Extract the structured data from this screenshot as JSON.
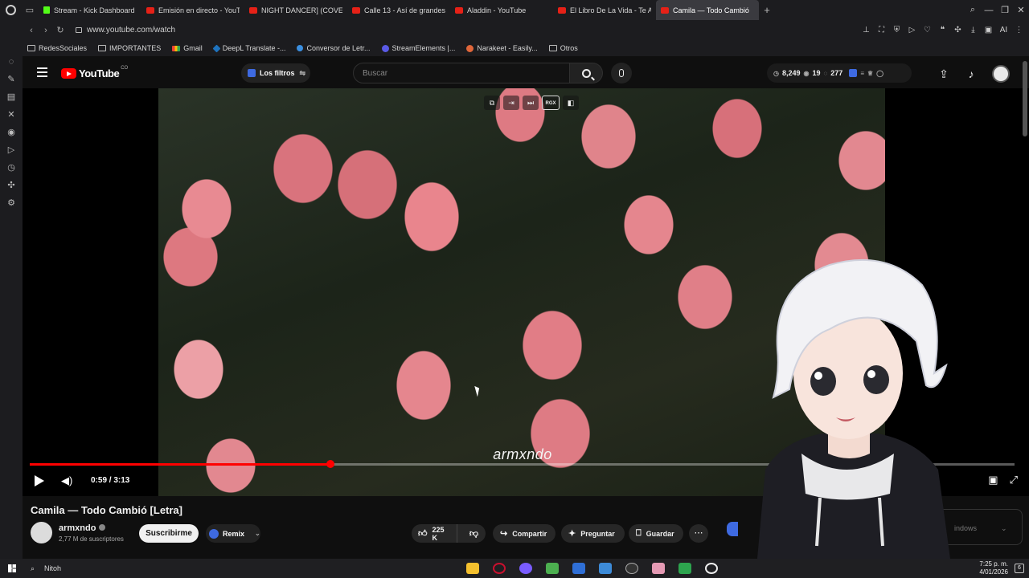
{
  "browser": {
    "tabs": [
      {
        "label": "Stream - Kick Dashboard",
        "icon": "kick-icon"
      },
      {
        "label": "Emisión en directo - YouTube",
        "icon": "youtube-icon"
      },
      {
        "label": "NIGHT DANCER] (COVER",
        "icon": "youtube-icon"
      },
      {
        "label": "Calle 13 - Así de grandes",
        "icon": "youtube-icon"
      },
      {
        "label": "Aladdin - YouTube",
        "icon": "youtube-icon"
      },
      {
        "label": "El Libro De La Vida - Te Amo",
        "icon": "youtube-icon"
      },
      {
        "label": "Camila — Todo Cambió",
        "icon": "youtube-icon",
        "active": true
      }
    ],
    "url": "www.youtube.com/watch",
    "bookmarks": [
      "RedesSociales",
      "IMPORTANTES",
      "Gmail",
      "DeepL Translate -...",
      "Conversor de Letr...",
      "StreamElements |...",
      "Narakeet - Easily...",
      "Otros"
    ]
  },
  "youtube": {
    "logo_text": "YouTube",
    "logo_suffix": "CO",
    "filters_label": "Los filtros",
    "search_placeholder": "Buscar",
    "stats": {
      "likes": "8,249",
      "views": "19",
      "comments": "277"
    }
  },
  "player": {
    "caption": "armxndo",
    "current_time": "0:59",
    "duration": "3:13",
    "time_display": "0:59 / 3:13",
    "progress_fraction": 0.305,
    "top_controls": [
      "copy-icon",
      "enter-icon",
      "skip-icon",
      "RGX",
      "sidebar-icon"
    ]
  },
  "video": {
    "title": "Camila — Todo Cambió [Letra]",
    "channel": "armxndo",
    "subscribers": "2,77 M de suscriptores",
    "subscribe_label": "Suscribirme",
    "remix_label": "Remix",
    "likes": "225 K",
    "share_label": "Compartir",
    "ask_label": "Preguntar",
    "save_label": "Guardar",
    "pip_text": "indows"
  },
  "taskbar": {
    "search_label": "Nitoh",
    "time": "7:25 p. m.",
    "date": "4/01/2026",
    "notif_count": "6"
  },
  "colors": {
    "accent": "#ff0000",
    "brand_blue": "#3e6ae1"
  }
}
